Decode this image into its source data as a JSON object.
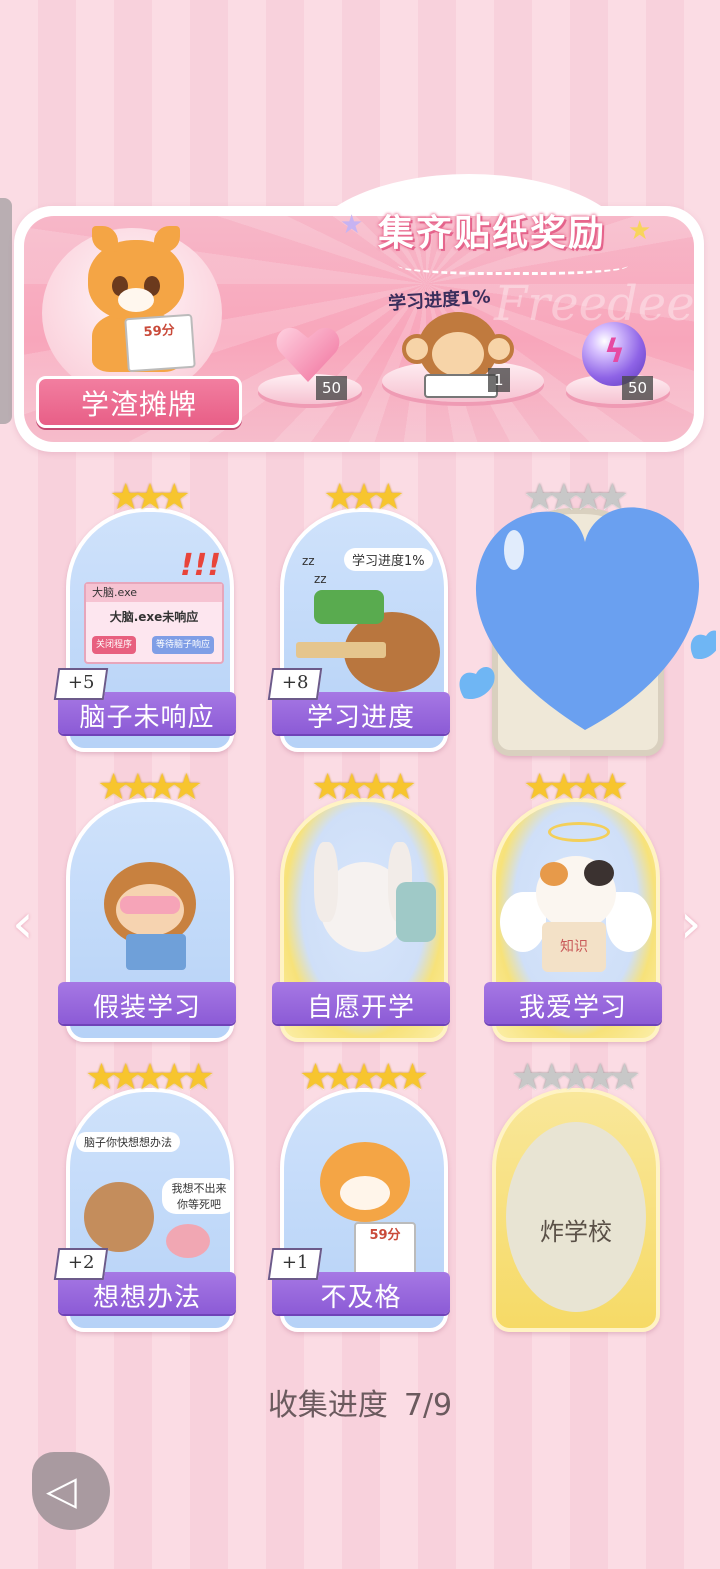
{
  "banner": {
    "title": "集齐贴纸奖励",
    "ghost_text": "Freedeem",
    "portrait_paper": "59分",
    "plate_label": "学渣摊牌",
    "progress_label": "学习进度1%",
    "rewards": [
      {
        "icon": "heart-gem-icon",
        "count": "50"
      },
      {
        "icon": "monkey-sticker-icon",
        "count": "1"
      },
      {
        "icon": "lightning-orb-icon",
        "count": "50"
      }
    ]
  },
  "cards": [
    {
      "title": "脑子未响应",
      "stars": "★★★",
      "badge": "+5",
      "window_title": "大脑.exe",
      "window_msg": "大脑.exe未响应",
      "btn1": "关闭程序",
      "btn2": "等待脑子响应"
    },
    {
      "title": "学习进度",
      "stars": "★★★",
      "badge": "+8",
      "bubble": "学习进度1%"
    },
    {
      "stars": "★★★★"
    },
    {
      "title": "假装学习",
      "stars": "★★★★"
    },
    {
      "title": "自愿开学",
      "stars": "★★★★"
    },
    {
      "title": "我爱学习",
      "stars": "★★★★",
      "book_text": "知识"
    },
    {
      "title": "想想办法",
      "stars": "★★★★★",
      "badge": "+2",
      "bubble1": "脑子你快想想办法",
      "bubble2": "我想不出来 你等死吧"
    },
    {
      "title": "不及格",
      "stars": "★★★★★",
      "badge": "+1",
      "paper": "59分"
    },
    {
      "locked_title": "炸学校",
      "stars": "★★★★★"
    }
  ],
  "footer": {
    "label": "收集进度",
    "value": "7/9"
  },
  "nav": {
    "left_arrow": "‹",
    "right_arrow": "›",
    "back_icon": "back-arrow-icon"
  },
  "colors": {
    "ribbon": "#9a68dc",
    "star_gold": "#f7c52e",
    "star_grey": "#c8c8c8",
    "banner_pink": "#f8a6bb"
  }
}
